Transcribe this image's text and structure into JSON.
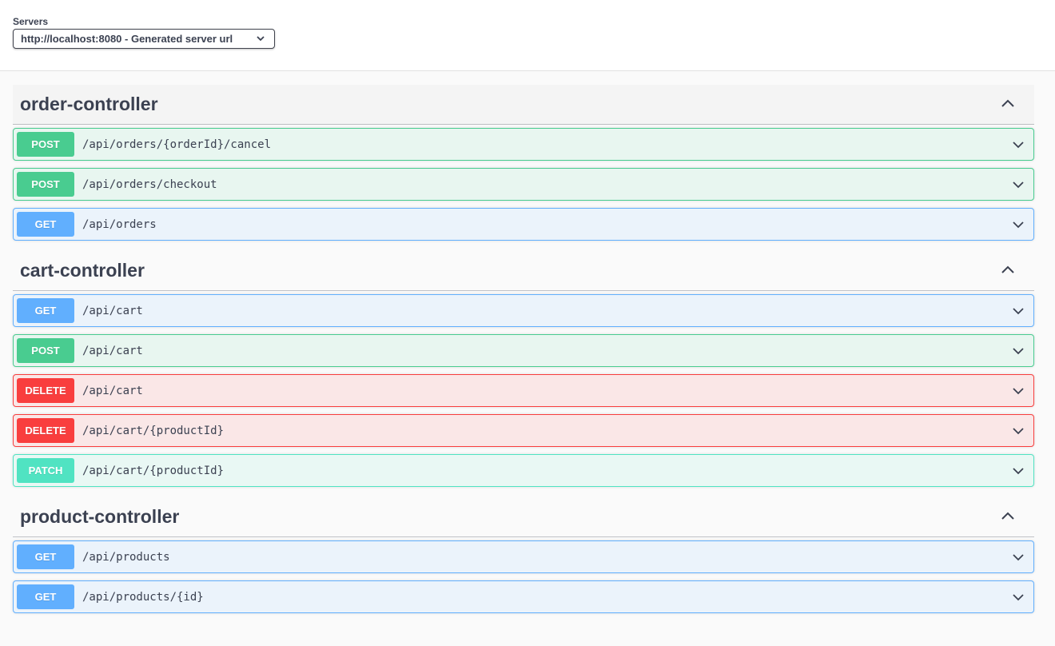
{
  "servers": {
    "label": "Servers",
    "selected": "http://localhost:8080 - Generated server url"
  },
  "tags": [
    {
      "name": "order-controller",
      "operations": [
        {
          "method": "POST",
          "path": "/api/orders/{orderId}/cancel"
        },
        {
          "method": "POST",
          "path": "/api/orders/checkout"
        },
        {
          "method": "GET",
          "path": "/api/orders"
        }
      ]
    },
    {
      "name": "cart-controller",
      "operations": [
        {
          "method": "GET",
          "path": "/api/cart"
        },
        {
          "method": "POST",
          "path": "/api/cart"
        },
        {
          "method": "DELETE",
          "path": "/api/cart"
        },
        {
          "method": "DELETE",
          "path": "/api/cart/{productId}"
        },
        {
          "method": "PATCH",
          "path": "/api/cart/{productId}"
        }
      ]
    },
    {
      "name": "product-controller",
      "operations": [
        {
          "method": "GET",
          "path": "/api/products"
        },
        {
          "method": "GET",
          "path": "/api/products/{id}"
        }
      ]
    }
  ],
  "colors": {
    "get": "#61affe",
    "post": "#49cc90",
    "delete": "#f93e3e",
    "patch": "#50e3c2"
  },
  "icons": {
    "select_arrow": "chevron-down-icon",
    "tag_toggle": "chevron-up-icon",
    "operation_expand": "chevron-down-icon"
  }
}
